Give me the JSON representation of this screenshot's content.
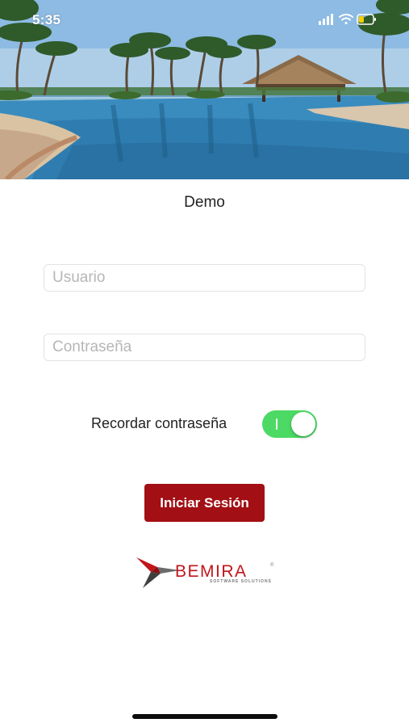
{
  "status_bar": {
    "time": "5:35",
    "icons": [
      "signal-icon",
      "wifi-icon",
      "battery-icon"
    ]
  },
  "hero": {
    "image": "resort pool with palm trees and thatched palapa"
  },
  "app": {
    "title": "Demo"
  },
  "login_form": {
    "username": {
      "placeholder": "Usuario",
      "value": ""
    },
    "password": {
      "placeholder": "Contraseña",
      "value": ""
    },
    "remember": {
      "label": "Recordar contraseña",
      "checked": true
    },
    "submit_label": "Iniciar Sesión"
  },
  "brand": {
    "name": "BEMIRA",
    "tagline": "SOFTWARE SOLUTIONS",
    "registered_mark": "®"
  },
  "colors": {
    "primary_button": "#a20f14",
    "toggle_on": "#4cd964",
    "brand_red": "#c0161c"
  }
}
